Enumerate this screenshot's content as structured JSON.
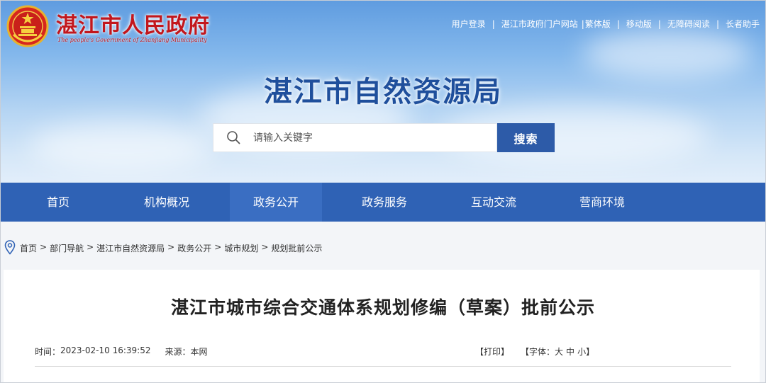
{
  "header": {
    "site_name": "湛江市人民政府",
    "site_subtitle": "The people's Government of Zhanjiang Municipality",
    "bureau_title": "湛江市自然资源局",
    "emblem_icon": "national-emblem-icon",
    "top_links": [
      "用户登录",
      "湛江市政府门户网站",
      "繁体版",
      "移动版",
      "无障碍阅读",
      "长者助手"
    ],
    "colors": {
      "site_name": "#c2171d",
      "bureau_title": "#1f4f9c"
    }
  },
  "search": {
    "placeholder": "请输入关键字",
    "button_label": "搜索",
    "icon": "search-icon"
  },
  "nav": {
    "items": [
      "首页",
      "机构概况",
      "政务公开",
      "政务服务",
      "互动交流",
      "营商环境"
    ],
    "active": "政务公开",
    "color": "#2f62b5"
  },
  "breadcrumb": {
    "icon": "location-pin-icon",
    "items": [
      "首页",
      "部门导航",
      "湛江市自然资源局",
      "政务公开",
      "城市规划",
      "规划批前公示"
    ],
    "separator": ">"
  },
  "article": {
    "title": "湛江市城市综合交通体系规划修编（草案）批前公示",
    "time_label": "时间：",
    "time": "2023-02-10 16:39:52",
    "source_label": "来源：",
    "source": "本网",
    "print_label": "【打印】",
    "font_label": "【字体：",
    "font_large": "大",
    "font_medium": "中",
    "font_small": "小",
    "font_close": "】"
  }
}
